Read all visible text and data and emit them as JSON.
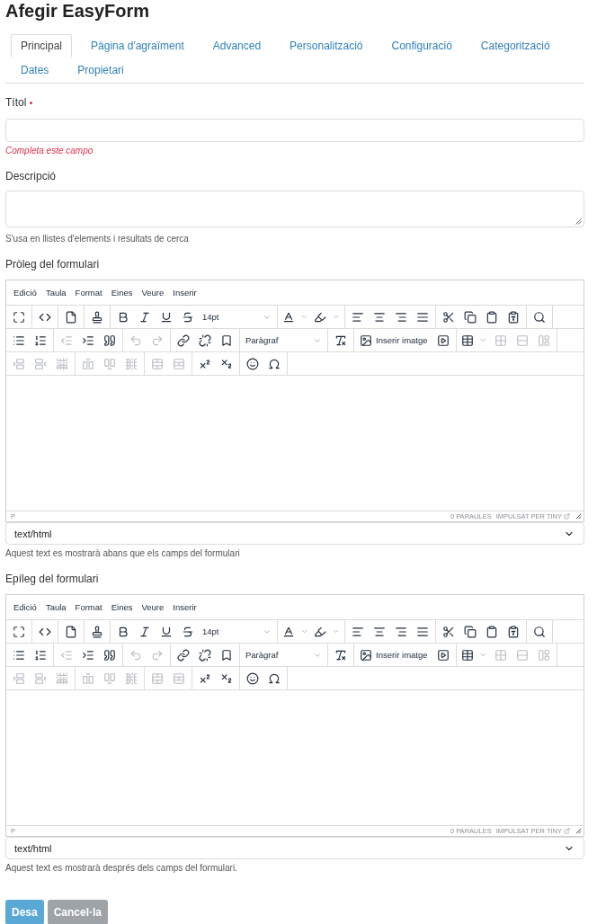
{
  "page": {
    "title": "Afegir EasyForm"
  },
  "tabs": [
    {
      "label": "Principal",
      "selected": true
    },
    {
      "label": "Pàgina d'agraïment",
      "selected": false
    },
    {
      "label": "Advanced",
      "selected": false
    },
    {
      "label": "Personalització",
      "selected": false
    },
    {
      "label": "Configuració",
      "selected": false
    },
    {
      "label": "Categorització",
      "selected": false
    },
    {
      "label": "Dates",
      "selected": false
    },
    {
      "label": "Propietari",
      "selected": false
    }
  ],
  "fields": [
    {
      "kind": "text",
      "label": "Títol",
      "required": true,
      "error": "Completa este campo"
    },
    {
      "kind": "textarea",
      "label": "Descripció",
      "required": false,
      "hint": "S'usa en llistes d'elements i resultats de cerca"
    },
    {
      "kind": "richtext",
      "label": "Pròleg del formulari",
      "required": false,
      "editor": {
        "menu": [
          "Edició",
          "Taula",
          "Format",
          "Eines",
          "Veure",
          "Inserir"
        ],
        "toolbar": [
          [
            [
              {
                "kind": "icon",
                "disabled": false
              }
            ],
            [
              {
                "kind": "icon",
                "disabled": false
              }
            ],
            [
              {
                "kind": "icon",
                "disabled": false
              }
            ],
            [
              {
                "kind": "icon",
                "disabled": false
              }
            ],
            [
              {
                "kind": "icon",
                "disabled": false
              },
              {
                "kind": "icon",
                "disabled": false
              },
              {
                "kind": "icon",
                "disabled": false
              },
              {
                "kind": "icon",
                "disabled": false
              },
              {
                "kind": "dropdown",
                "label": "14pt",
                "disabled": false
              }
            ],
            [
              {
                "kind": "split",
                "disabled": false
              },
              {
                "kind": "split",
                "disabled": false
              }
            ],
            [
              {
                "kind": "icon",
                "disabled": false
              },
              {
                "kind": "icon",
                "disabled": false
              },
              {
                "kind": "icon",
                "disabled": false
              },
              {
                "kind": "icon",
                "disabled": false
              }
            ],
            [
              {
                "kind": "icon",
                "disabled": false
              },
              {
                "kind": "icon",
                "disabled": false
              },
              {
                "kind": "icon",
                "disabled": false
              },
              {
                "kind": "icon",
                "disabled": false
              }
            ],
            [
              {
                "kind": "icon",
                "disabled": false
              }
            ]
          ],
          [
            [
              {
                "kind": "icon",
                "disabled": false
              },
              {
                "kind": "icon",
                "disabled": false
              }
            ],
            [
              {
                "kind": "icon",
                "disabled": true
              },
              {
                "kind": "icon",
                "disabled": false
              },
              {
                "kind": "icon",
                "disabled": false
              }
            ],
            [
              {
                "kind": "icon",
                "disabled": true
              },
              {
                "kind": "icon",
                "disabled": true
              }
            ],
            [
              {
                "kind": "icon",
                "disabled": false
              },
              {
                "kind": "icon",
                "disabled": false
              },
              {
                "kind": "icon",
                "disabled": false
              }
            ],
            [
              {
                "kind": "dropdown",
                "label": "Paràgraf",
                "disabled": false
              }
            ],
            [
              {
                "kind": "icon",
                "disabled": false
              }
            ],
            [
              {
                "kind": "labelled",
                "label": "Inserir imatge",
                "disabled": false
              },
              {
                "kind": "icon",
                "disabled": false
              }
            ],
            [
              {
                "kind": "split",
                "disabled": false
              },
              {
                "kind": "icon",
                "disabled": true
              },
              {
                "kind": "icon",
                "disabled": true
              },
              {
                "kind": "icon",
                "disabled": true
              }
            ]
          ],
          [
            [
              {
                "kind": "icon",
                "disabled": true
              },
              {
                "kind": "icon",
                "disabled": true
              },
              {
                "kind": "icon",
                "disabled": true
              }
            ],
            [
              {
                "kind": "icon",
                "disabled": true
              },
              {
                "kind": "icon",
                "disabled": true
              },
              {
                "kind": "icon",
                "disabled": true
              }
            ],
            [
              {
                "kind": "icon",
                "disabled": true
              },
              {
                "kind": "icon",
                "disabled": true
              }
            ],
            [
              {
                "kind": "icon",
                "disabled": false
              },
              {
                "kind": "icon",
                "disabled": false
              }
            ],
            [
              {
                "kind": "icon",
                "disabled": false
              },
              {
                "kind": "icon",
                "disabled": false
              }
            ]
          ]
        ],
        "status": {
          "path": "P",
          "words": "0 PARAULES",
          "brand": "IMPULSAT PER TINY"
        }
      },
      "format": "text/html",
      "hint": "Aquest text es mostrarà abans que els camps del formulari"
    },
    {
      "kind": "richtext",
      "label": "Epíleg del formulari",
      "required": false,
      "editor": {
        "menu": [
          "Edició",
          "Taula",
          "Format",
          "Eines",
          "Veure",
          "Inserir"
        ],
        "toolbar": [
          [
            [
              {
                "kind": "icon",
                "disabled": false
              }
            ],
            [
              {
                "kind": "icon",
                "disabled": false
              }
            ],
            [
              {
                "kind": "icon",
                "disabled": false
              }
            ],
            [
              {
                "kind": "icon",
                "disabled": false
              }
            ],
            [
              {
                "kind": "icon",
                "disabled": false
              },
              {
                "kind": "icon",
                "disabled": false
              },
              {
                "kind": "icon",
                "disabled": false
              },
              {
                "kind": "icon",
                "disabled": false
              },
              {
                "kind": "dropdown",
                "label": "14pt",
                "disabled": false
              }
            ],
            [
              {
                "kind": "split",
                "disabled": false
              },
              {
                "kind": "split",
                "disabled": false
              }
            ],
            [
              {
                "kind": "icon",
                "disabled": false
              },
              {
                "kind": "icon",
                "disabled": false
              },
              {
                "kind": "icon",
                "disabled": false
              },
              {
                "kind": "icon",
                "disabled": false
              }
            ],
            [
              {
                "kind": "icon",
                "disabled": false
              },
              {
                "kind": "icon",
                "disabled": false
              },
              {
                "kind": "icon",
                "disabled": false
              },
              {
                "kind": "icon",
                "disabled": false
              }
            ],
            [
              {
                "kind": "icon",
                "disabled": false
              }
            ]
          ],
          [
            [
              {
                "kind": "icon",
                "disabled": false
              },
              {
                "kind": "icon",
                "disabled": false
              }
            ],
            [
              {
                "kind": "icon",
                "disabled": true
              },
              {
                "kind": "icon",
                "disabled": false
              },
              {
                "kind": "icon",
                "disabled": false
              }
            ],
            [
              {
                "kind": "icon",
                "disabled": true
              },
              {
                "kind": "icon",
                "disabled": true
              }
            ],
            [
              {
                "kind": "icon",
                "disabled": false
              },
              {
                "kind": "icon",
                "disabled": false
              },
              {
                "kind": "icon",
                "disabled": false
              }
            ],
            [
              {
                "kind": "dropdown",
                "label": "Paràgraf",
                "disabled": false
              }
            ],
            [
              {
                "kind": "icon",
                "disabled": false
              }
            ],
            [
              {
                "kind": "labelled",
                "label": "Inserir imatge",
                "disabled": false
              },
              {
                "kind": "icon",
                "disabled": false
              }
            ],
            [
              {
                "kind": "split",
                "disabled": false
              },
              {
                "kind": "icon",
                "disabled": true
              },
              {
                "kind": "icon",
                "disabled": true
              },
              {
                "kind": "icon",
                "disabled": true
              }
            ]
          ],
          [
            [
              {
                "kind": "icon",
                "disabled": true
              },
              {
                "kind": "icon",
                "disabled": true
              },
              {
                "kind": "icon",
                "disabled": true
              }
            ],
            [
              {
                "kind": "icon",
                "disabled": true
              },
              {
                "kind": "icon",
                "disabled": true
              },
              {
                "kind": "icon",
                "disabled": true
              }
            ],
            [
              {
                "kind": "icon",
                "disabled": true
              },
              {
                "kind": "icon",
                "disabled": true
              }
            ],
            [
              {
                "kind": "icon",
                "disabled": false
              },
              {
                "kind": "icon",
                "disabled": false
              }
            ],
            [
              {
                "kind": "icon",
                "disabled": false
              },
              {
                "kind": "icon",
                "disabled": false
              }
            ]
          ]
        ],
        "status": {
          "path": "P",
          "words": "0 PARAULES",
          "brand": "IMPULSAT PER TINY"
        }
      },
      "format": "text/html",
      "hint": "Aquest text es mostrarà després dels camps del formulari."
    }
  ],
  "buttons": [
    {
      "label": "Desa",
      "kind": "primary"
    },
    {
      "label": "Cancel·la",
      "kind": "secondary"
    }
  ]
}
